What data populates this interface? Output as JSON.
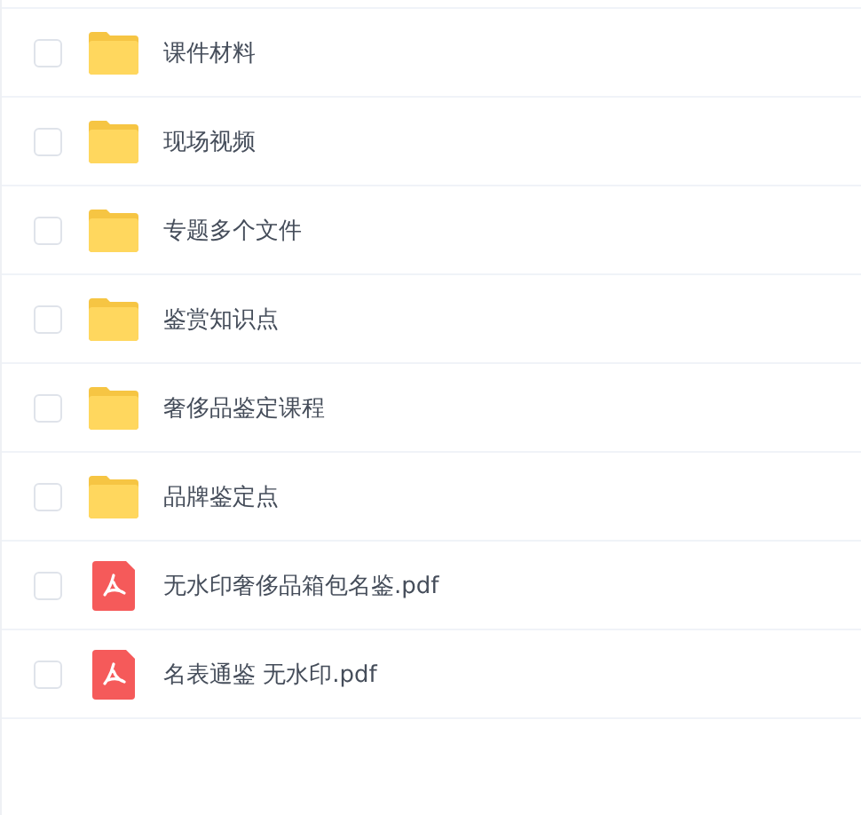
{
  "files": [
    {
      "kind": "folder",
      "name": "课件材料",
      "checked": false
    },
    {
      "kind": "folder",
      "name": "现场视频",
      "checked": false
    },
    {
      "kind": "folder",
      "name": "专题多个文件",
      "checked": false
    },
    {
      "kind": "folder",
      "name": "鉴赏知识点",
      "checked": false
    },
    {
      "kind": "folder",
      "name": "奢侈品鉴定课程",
      "checked": false
    },
    {
      "kind": "folder",
      "name": "品牌鉴定点",
      "checked": false
    },
    {
      "kind": "pdf",
      "name": "无水印奢侈品箱包名鉴.pdf",
      "checked": false
    },
    {
      "kind": "pdf",
      "name": "名表通鉴 无水印.pdf",
      "checked": false
    }
  ]
}
